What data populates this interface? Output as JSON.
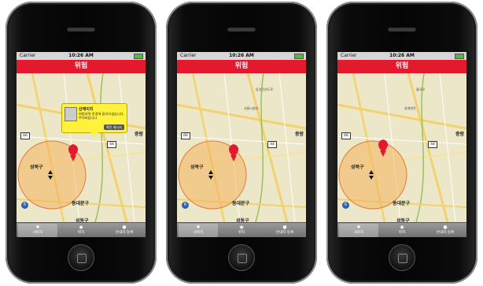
{
  "status_bar": {
    "carrier": "Carrier",
    "time": "10:26 AM"
  },
  "nav": {
    "title": "위험"
  },
  "map": {
    "labels": {
      "district_seongbuk": "성북구",
      "district_dongdaemun": "동대문구",
      "district_seongdong": "성동구",
      "district_jung": "중랑",
      "road_a": "월곡로",
      "road_b": "서울시청로",
      "road_c": "청계천로",
      "road_d": "동부간선도로"
    },
    "badge_6": "6",
    "sign_66": "66",
    "sign_44": "44",
    "sign_6": "6",
    "alert_zone_color": "#f5b25e",
    "pin_color": "#e3192e"
  },
  "popup": {
    "title": "산재이치",
    "message": "위험지역 반경에 들어오셨습니다. 주의바랍니다",
    "button": "확인 메시지"
  },
  "tabs": [
    {
      "icon": "alert-icon",
      "label": "내위치"
    },
    {
      "icon": "pin-icon",
      "label": "위치"
    },
    {
      "icon": "person-icon",
      "label": "안내자 등록"
    }
  ],
  "colors": {
    "accent": "#e3192e",
    "tabbar": "#7a7a7a"
  }
}
